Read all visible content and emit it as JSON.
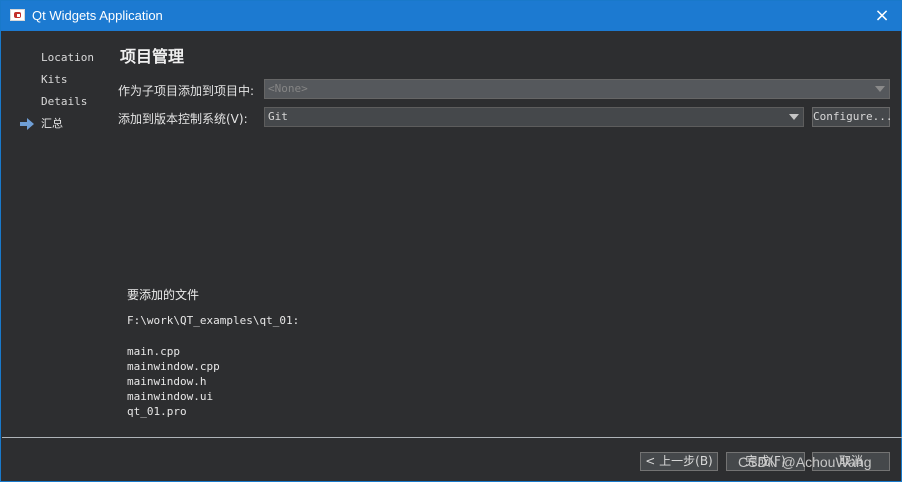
{
  "window": {
    "title": "Qt Widgets Application",
    "close_glyph": "×"
  },
  "sidebar": {
    "items": [
      {
        "label": "Location"
      },
      {
        "label": "Kits"
      },
      {
        "label": "Details"
      },
      {
        "label": "汇总"
      }
    ],
    "active_index": 3
  },
  "main": {
    "heading": "项目管理",
    "add_as_subproject_label": "作为子项目添加到项目中:",
    "add_as_subproject_value": "<None>",
    "version_control_label": "添加到版本控制系统(V):",
    "version_control_value": "Git",
    "configure_button": "Configure..."
  },
  "files": {
    "title": "要添加的文件",
    "path": "F:\\work\\QT_examples\\qt_01:",
    "items": [
      "main.cpp",
      "mainwindow.cpp",
      "mainwindow.h",
      "mainwindow.ui",
      "qt_01.pro"
    ]
  },
  "footer": {
    "back_button": "< 上一步(B)",
    "finish_button": "完成(F)",
    "cancel_button": "取消",
    "watermark": "CSDN @AchouWang"
  },
  "colors": {
    "titlebar": "#1c7ad1",
    "background": "#2d2e30",
    "arrow": "#6f9fd6"
  },
  "icons": {
    "app": "qt-app-icon",
    "close": "close-icon",
    "active_arrow": "arrow-right-icon",
    "dropdown": "chevron-down-icon"
  }
}
